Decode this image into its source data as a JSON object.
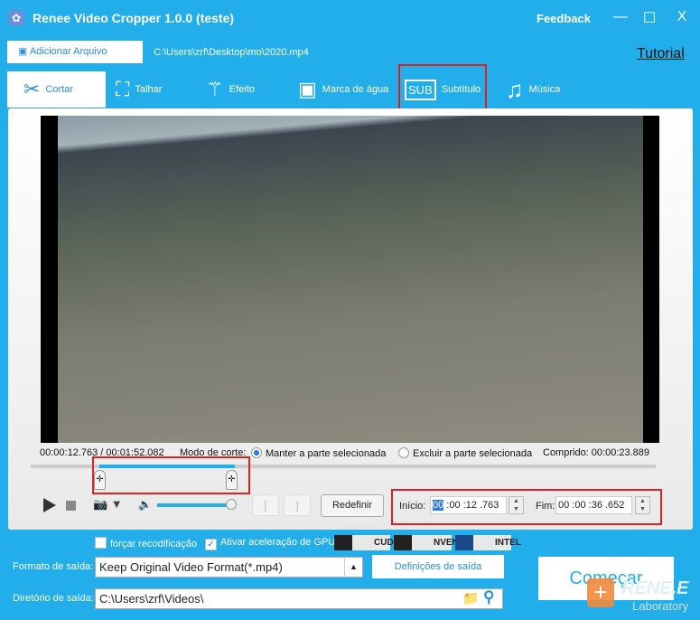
{
  "window": {
    "title": "Renee Video Cropper 1.0.0 (teste)",
    "feedback": "Feedback",
    "minimize": "—",
    "maximize": "☐",
    "close": "X"
  },
  "toolbar": {
    "add_file": "Adicionar Arquivo",
    "file_path": "C:\\Users\\zrf\\Desktop\\mo\\2020.mp4",
    "tutorial": "Tutorial"
  },
  "tabs": [
    {
      "label": "Cortar",
      "icon": "scissors-icon"
    },
    {
      "label": "Talhar",
      "icon": "crop-icon"
    },
    {
      "label": "Efeito",
      "icon": "magic-wand-icon"
    },
    {
      "label": "Marca de água",
      "icon": "watermark-icon"
    },
    {
      "label": "Subtítulo",
      "icon": "subtitle-icon"
    },
    {
      "label": "Música",
      "icon": "music-icon"
    }
  ],
  "player": {
    "time": "00:00:12.763 / 00:01:52.082",
    "mode_label": "Modo de corte:",
    "mode_keep": "Manter a parte selecionada",
    "mode_exclude": "Excluir a parte selecionada",
    "length": "Comprido: 00:00:23.889",
    "reset": "Redefinir",
    "start_label": "Início:",
    "start_hl": "00",
    "start_rest": " :00 :12 .763",
    "end_label": "Fim:",
    "end_value": "00 :00 :36 .652",
    "volume_percent": 95
  },
  "options": {
    "force_reencode": "forçar recodificação",
    "gpu_accel": "Ativar aceleração de GPU",
    "gpu": [
      "CUDA",
      "NVENC",
      "INTEL"
    ]
  },
  "output": {
    "format_label": "Formato de saída:",
    "format_value": "Keep Original Video Format(*.mp4)",
    "settings": "Definições de saída",
    "dir_label": "Diretório de saída:",
    "dir_value": "C:\\Users\\zrf\\Videos\\",
    "start": "Começar"
  },
  "watermark": {
    "brand": "RENE.E",
    "sub": "Laboratory"
  }
}
